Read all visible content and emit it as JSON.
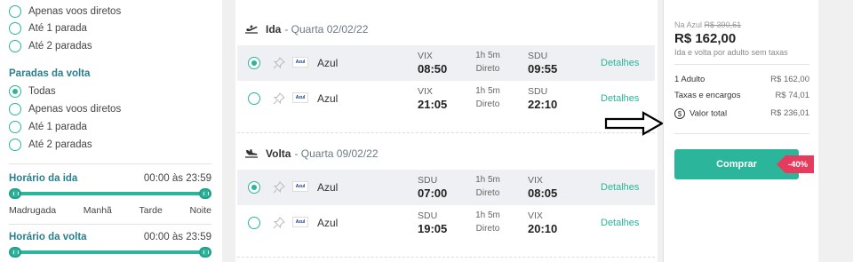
{
  "sidebar": {
    "ida_options": [
      {
        "label": "Apenas voos diretos",
        "checked": false
      },
      {
        "label": "Até 1 parada",
        "checked": false
      },
      {
        "label": "Até 2 paradas",
        "checked": false
      }
    ],
    "volta_title": "Paradas da volta",
    "volta_options": [
      {
        "label": "Todas",
        "checked": true
      },
      {
        "label": "Apenas voos diretos",
        "checked": false
      },
      {
        "label": "Até 1 parada",
        "checked": false
      },
      {
        "label": "Até 2 paradas",
        "checked": false
      }
    ],
    "horario_ida": {
      "title": "Horário da ida",
      "range": "00:00 às 23:59",
      "periods": [
        "Madrugada",
        "Manhã",
        "Tarde",
        "Noite"
      ]
    },
    "horario_volta": {
      "title": "Horário da volta",
      "range": "00:00 às 23:59"
    }
  },
  "flights": {
    "ida": {
      "title": "Ida",
      "date": "- Quarta 02/02/22",
      "rows": [
        {
          "airline": "Azul",
          "from": "VIX",
          "dep": "08:50",
          "duration": "1h 5m",
          "type": "Direto",
          "to": "SDU",
          "arr": "09:55",
          "details": "Detalhes",
          "selected": true
        },
        {
          "airline": "Azul",
          "from": "VIX",
          "dep": "21:05",
          "duration": "1h 5m",
          "type": "Direto",
          "to": "SDU",
          "arr": "22:10",
          "details": "Detalhes",
          "selected": false
        }
      ]
    },
    "volta": {
      "title": "Volta",
      "date": "- Quarta 09/02/22",
      "rows": [
        {
          "airline": "Azul",
          "from": "SDU",
          "dep": "07:00",
          "duration": "1h 5m",
          "type": "Direto",
          "to": "VIX",
          "arr": "08:05",
          "details": "Detalhes",
          "selected": true
        },
        {
          "airline": "Azul",
          "from": "SDU",
          "dep": "19:05",
          "duration": "1h 5m",
          "type": "Direto",
          "to": "VIX",
          "arr": "20:10",
          "details": "Detalhes",
          "selected": false
        }
      ]
    },
    "logo_text": "Azul"
  },
  "summary": {
    "na_azul_label": "Na Azul",
    "old_price": "R$ 390,61",
    "price": "R$ 162,00",
    "price_note": "Ida e volta por adulto sem taxas",
    "adult_label": "1 Adulto",
    "adult_value": "R$ 162,00",
    "taxes_label": "Taxas e encargos",
    "taxes_value": "R$ 74,01",
    "total_label": "Valor total",
    "total_value": "R$ 236,01",
    "buy_label": "Comprar",
    "discount": "-40%"
  },
  "colors": {
    "accent": "#2bb59a",
    "discount": "#e63b5c",
    "section_title": "#2a7f8f"
  }
}
